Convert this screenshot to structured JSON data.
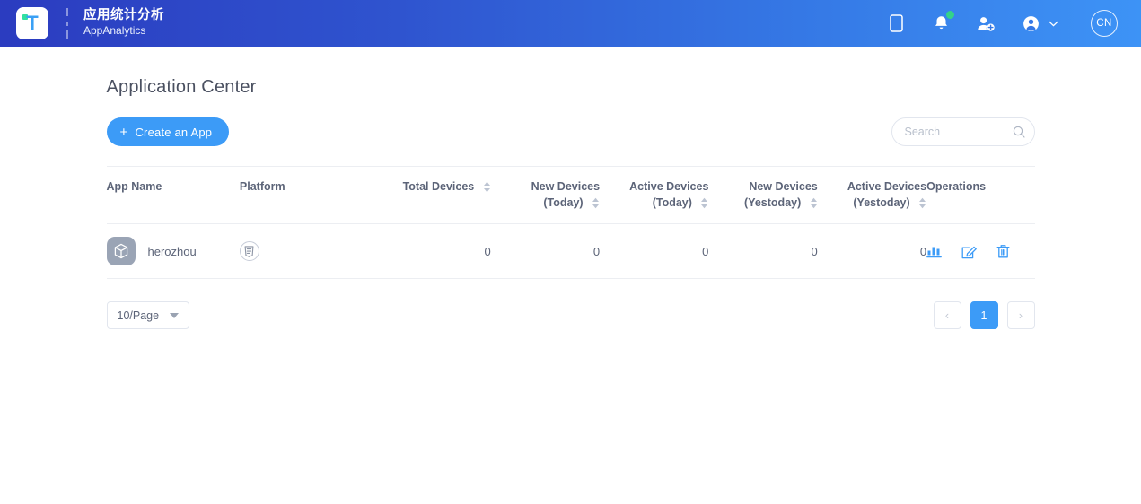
{
  "header": {
    "logo_letter": "T",
    "brand_cn": "应用统计分析",
    "brand_en": "AppAnalytics",
    "icons": {
      "device": "mobile-device-icon",
      "notifications": "bell-icon",
      "add_user": "add-user-icon",
      "account": "user-account-icon",
      "chevron": "chevron-down-icon"
    },
    "avatar_initials": "CN"
  },
  "page": {
    "title": "Application Center"
  },
  "toolbar": {
    "create_label": "Create an App",
    "create_plus": "+",
    "search_placeholder": "Search",
    "search_value": ""
  },
  "table": {
    "columns": [
      {
        "label_line1": "App Name",
        "label_line2": "",
        "sortable": false,
        "align": "left"
      },
      {
        "label_line1": "Platform",
        "label_line2": "",
        "sortable": false,
        "align": "left"
      },
      {
        "label_line1": "Total Devices",
        "label_line2": "",
        "sortable": true,
        "align": "right"
      },
      {
        "label_line1": "New Devices",
        "label_line2": "(Today)",
        "sortable": true,
        "align": "right"
      },
      {
        "label_line1": "Active Devices",
        "label_line2": "(Today)",
        "sortable": true,
        "align": "right"
      },
      {
        "label_line1": "New Devices",
        "label_line2": "(Yestoday)",
        "sortable": true,
        "align": "right"
      },
      {
        "label_line1": "Active Devices",
        "label_line2": "(Yestoday)",
        "sortable": true,
        "align": "right"
      },
      {
        "label_line1": "Operations",
        "label_line2": "",
        "sortable": false,
        "align": "left"
      }
    ],
    "rows": [
      {
        "app_name": "herozhou",
        "app_icon": "package-box-icon",
        "platform_icon": "html5-platform-icon",
        "total_devices": "0",
        "new_devices_today": "0",
        "active_devices_today": "0",
        "new_devices_yesterday": "0",
        "active_devices_yesterday": "0",
        "operations": [
          "statistics-icon",
          "edit-icon",
          "delete-icon"
        ]
      }
    ]
  },
  "footer": {
    "page_size_label": "10/Page",
    "prev_label": "‹",
    "next_label": "›",
    "pages": [
      "1"
    ],
    "current_page": "1"
  },
  "colors": {
    "accent": "#3c9bf7",
    "header_gradient_start": "#2b3cc0",
    "header_gradient_end": "#3d93f6",
    "notification_dot": "#34d28a",
    "text_primary": "#5c6478",
    "border": "#eceef2"
  }
}
